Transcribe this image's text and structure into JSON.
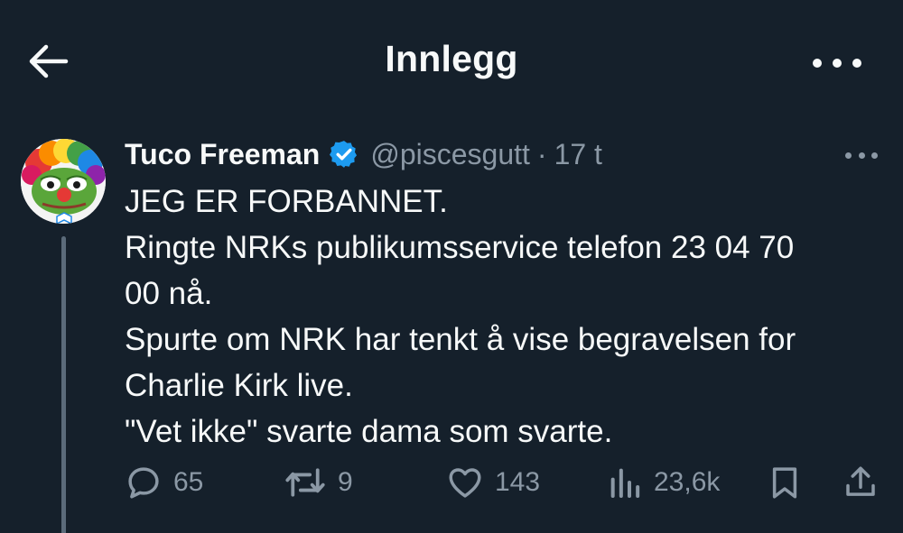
{
  "header": {
    "title": "Innlegg",
    "back_icon": "arrow-left-icon",
    "more_icon": "more-horizontal-icon"
  },
  "post": {
    "author_name": "Tuco Freeman",
    "handle": "@piscesgutt",
    "separator": "·",
    "time": "17 t",
    "verified": true,
    "text_lines": [
      "JEG ER FORBANNET.",
      "Ringte NRKs publikumsservice telefon 23 04 70",
      "00 nå.",
      "Spurte om NRK har tenkt å vise begravelsen for",
      "Charlie Kirk live.",
      "\"Vet ikke\" svarte dama som svarte."
    ]
  },
  "actions": {
    "replies": "65",
    "reposts": "9",
    "likes": "143",
    "views": "23,6k"
  },
  "colors": {
    "background": "#15202b",
    "text": "#f7f9f9",
    "secondary": "#8b98a5",
    "verified": "#1d9bf0"
  }
}
